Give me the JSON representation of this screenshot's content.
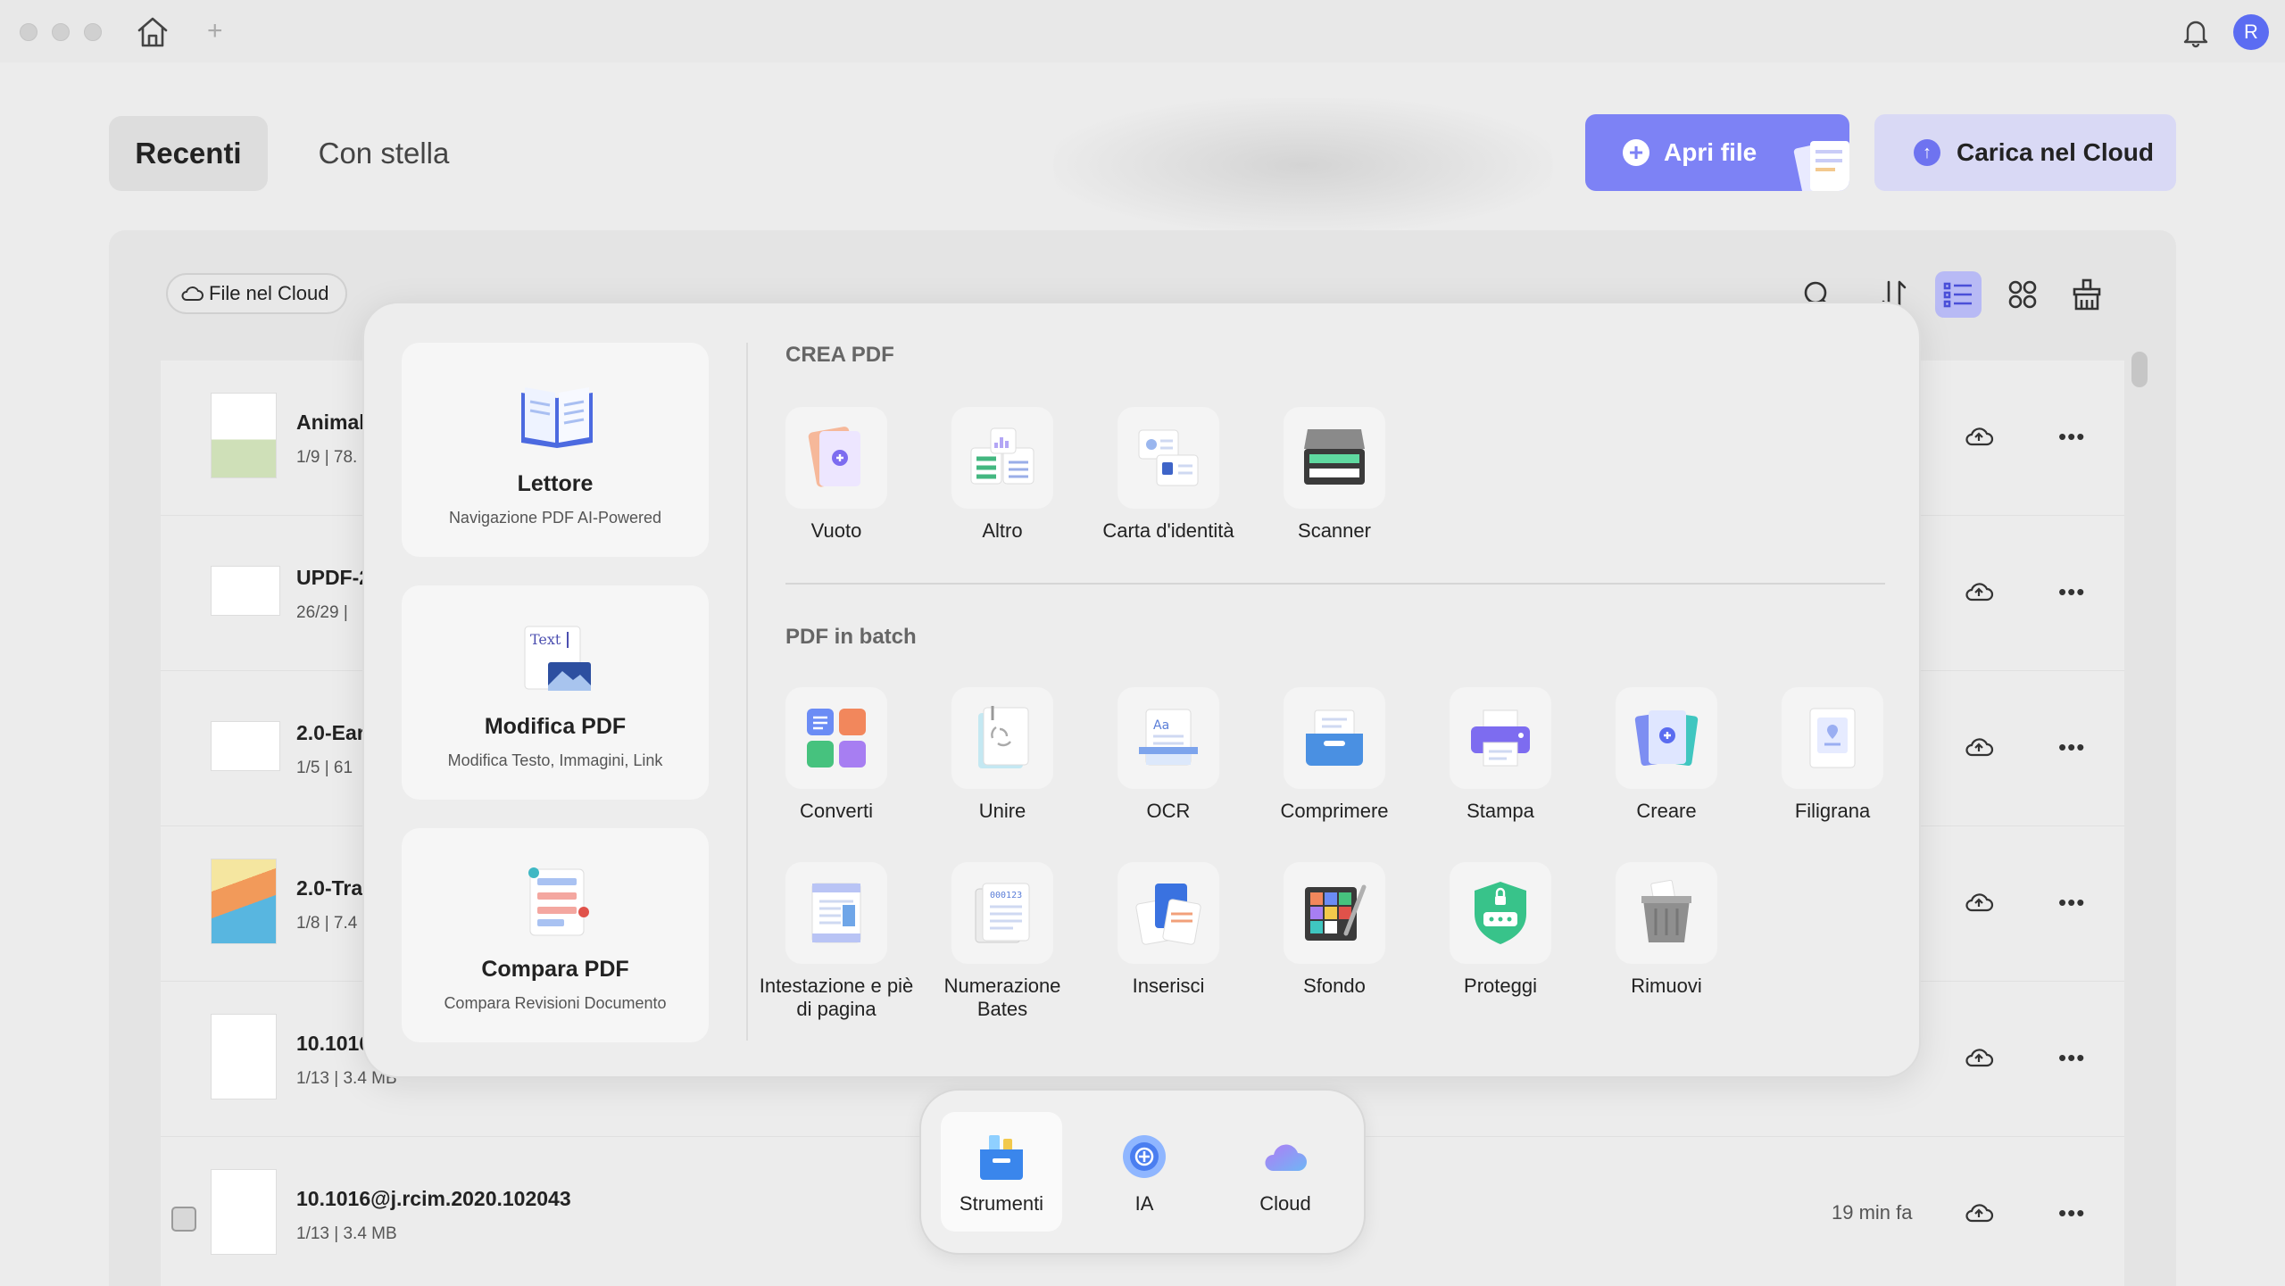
{
  "window": {
    "avatar_letter": "R"
  },
  "tabs": {
    "recent": "Recenti",
    "starred": "Con stella"
  },
  "buttons": {
    "open_file": "Apri file",
    "upload_cloud": "Carica nel Cloud"
  },
  "filter": {
    "cloud_files": "File nel Cloud"
  },
  "files": [
    {
      "name": "Animal",
      "meta": "1/9 | 78."
    },
    {
      "name": "UPDF-2",
      "meta": "26/29 |"
    },
    {
      "name": "2.0-Ear",
      "meta": "1/5 | 61"
    },
    {
      "name": "2.0-Tra",
      "meta": "1/8 | 7.4"
    },
    {
      "name": "10.1016",
      "meta": "1/13 | 3.4 MB"
    },
    {
      "name": "10.1016@j.rcim.2020.102043",
      "meta": "1/13 | 3.4 MB",
      "time": "19 min fa"
    }
  ],
  "popup": {
    "cards": [
      {
        "title": "Lettore",
        "sub": "Navigazione PDF AI-Powered"
      },
      {
        "title": "Modifica PDF",
        "sub": "Modifica Testo, Immagini, Link"
      },
      {
        "title": "Compara PDF",
        "sub": "Compara Revisioni Documento"
      }
    ],
    "create_title": "CREA PDF",
    "create_tools": [
      "Vuoto",
      "Altro",
      "Carta d'identità",
      "Scanner"
    ],
    "batch_title": "PDF in batch",
    "batch_row1": [
      "Converti",
      "Unire",
      "OCR",
      "Comprimere",
      "Stampa",
      "Creare",
      "Filigrana"
    ],
    "batch_row2": [
      "Intestazione e piè di pagina",
      "Numerazione Bates",
      "Inserisci",
      "Sfondo",
      "Proteggi",
      "Rimuovi"
    ]
  },
  "dock": {
    "tools": "Strumenti",
    "ai": "IA",
    "cloud": "Cloud"
  },
  "colors": {
    "accent": "#7d82f5",
    "accent_light": "#d9d9f5"
  }
}
